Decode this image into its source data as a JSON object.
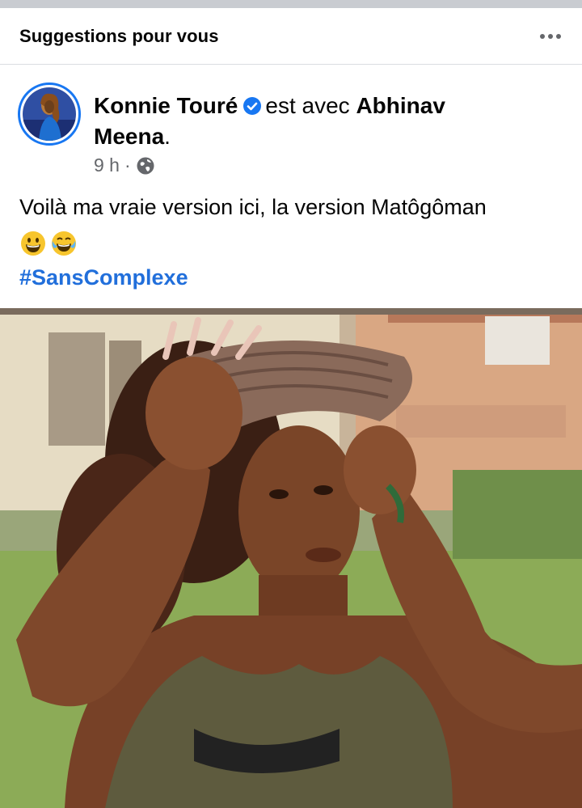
{
  "section": {
    "title": "Suggestions pour vous",
    "more_icon": "more-horizontal-icon"
  },
  "post": {
    "author": "Konnie Touré",
    "verified_icon": "verified-badge-icon",
    "with_text": "est avec",
    "tagged_first": "Abhinav",
    "tagged_last": "Meena",
    "period": ".",
    "time": "9 h",
    "separator": "·",
    "privacy_icon": "globe-icon",
    "text": "Voilà ma vraie version ici, la version Matôgôman",
    "emojis": [
      "grinning-face-icon",
      "tears-of-joy-icon"
    ],
    "hashtag": "#SansComplexe"
  },
  "colors": {
    "accent": "#1877f2",
    "link": "#216fdb",
    "secondary_text": "#65676b"
  }
}
